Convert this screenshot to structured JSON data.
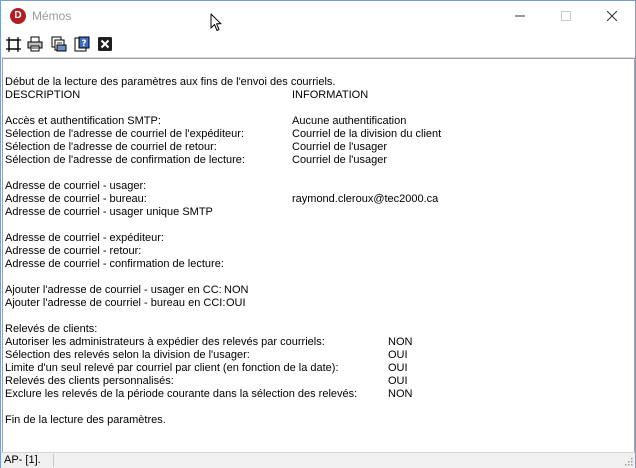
{
  "window": {
    "title": "Mémos",
    "app_icon_letter": "D"
  },
  "toolbar": {
    "buttons": [
      {
        "name": "fit-page-icon"
      },
      {
        "name": "print-icon"
      },
      {
        "name": "print-preview-icon"
      },
      {
        "name": "help-icon"
      },
      {
        "name": "close-document-icon"
      }
    ]
  },
  "report": {
    "intro": "Début de la lecture des paramètres aux fins de l'envoi des courriels.",
    "col_description": "DESCRIPTION",
    "col_information": "INFORMATION",
    "smtp": [
      {
        "label": "Accès et authentification SMTP:",
        "value": "Aucune authentification"
      },
      {
        "label": "Sélection de l'adresse de courriel de l'expéditeur:",
        "value": "Courriel de la division du client"
      },
      {
        "label": "Sélection de l'adresse de courriel de retour:",
        "value": "Courriel de l'usager"
      },
      {
        "label": "Sélection de l'adresse de confirmation de lecture:",
        "value": "Courriel de l'usager"
      }
    ],
    "addresses1": [
      {
        "label": "Adresse de courriel - usager:",
        "value": ""
      },
      {
        "label": "Adresse de courriel - bureau:",
        "value": "raymond.cleroux@tec2000.ca"
      },
      {
        "label": "Adresse de courriel - usager unique SMTP",
        "value": ""
      }
    ],
    "addresses2": [
      {
        "label": "Adresse de courriel - expéditeur:"
      },
      {
        "label": "Adresse de courriel - retour:"
      },
      {
        "label": "Adresse de courriel - confirmation de lecture:"
      }
    ],
    "cc": [
      {
        "label": "Ajouter l'adresse de courriel - usager en CC:",
        "value": "NON"
      },
      {
        "label": "Ajouter l'adresse de courriel - bureau en CCI:",
        "value": "OUI"
      }
    ],
    "statements_title": "Relevés de clients:",
    "statements": [
      {
        "label": "Autoriser les administrateurs à expédier des relevés par courriels:",
        "value": "NON"
      },
      {
        "label": "Sélection des relevés selon la division de l'usager:",
        "value": "OUI"
      },
      {
        "label": "Limite d'un seul relevé par courriel par client (en fonction de la date):",
        "value": "OUI"
      },
      {
        "label": "Relevés des clients personnalisés:",
        "value": "OUI"
      },
      {
        "label": "Exclure les relevés de la période courante dans la sélection des relevés:",
        "value": "NON"
      }
    ],
    "end": "Fin de la lecture des paramètres."
  },
  "status": {
    "text": "AP- [1]."
  }
}
